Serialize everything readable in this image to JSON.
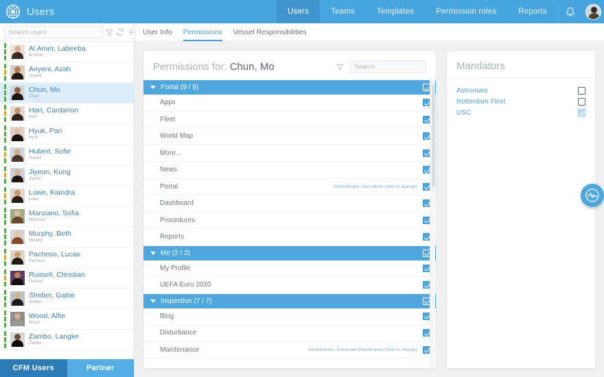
{
  "header": {
    "brand_title": "Users",
    "logo_icon": "compass-wheel-icon",
    "nav": [
      {
        "label": "Users",
        "active": true
      },
      {
        "label": "Teams",
        "active": false
      },
      {
        "label": "Templates",
        "active": false
      },
      {
        "label": "Permission roles",
        "active": false
      },
      {
        "label": "Reports",
        "active": false
      }
    ],
    "bell_icon": "bell-icon",
    "avatar_icon": "user-avatar"
  },
  "sidebar": {
    "search_placeholder": "Search users",
    "search_value": "",
    "tools": [
      {
        "icon": "filter-icon"
      },
      {
        "icon": "refresh-icon"
      },
      {
        "icon": "plus-icon"
      }
    ],
    "users": [
      {
        "name": "Al Amer, Labeeba",
        "sub": "Al Amer",
        "selected": false,
        "skin": "#d8a98c",
        "hair": "#3a2b22",
        "bg": "#e9e2d8",
        "bar2": "green"
      },
      {
        "name": "Anyeni, Azah",
        "sub": "Anyeni",
        "selected": false,
        "skin": "#b07c55",
        "hair": "#241a14",
        "bg": "#d7ccc0",
        "bar2": "amber"
      },
      {
        "name": "Chun, Mo",
        "sub": "Chun",
        "selected": true,
        "skin": "#8d5f3c",
        "hair": "#1f1611",
        "bg": "#cfd5d8",
        "bar2": "green"
      },
      {
        "name": "Hart, Cardarion",
        "sub": "Hart",
        "selected": false,
        "skin": "#c79070",
        "hair": "#30211a",
        "bg": "#e3d9cd",
        "bar2": "amber"
      },
      {
        "name": "Hyuk, Pan",
        "sub": "Hyuk",
        "selected": false,
        "skin": "#e4bda0",
        "hair": "#171210",
        "bg": "#ded3c6",
        "bar2": "green"
      },
      {
        "name": "Hubert, Sofie",
        "sub": "Hubert",
        "selected": false,
        "skin": "#d6a884",
        "hair": "#4a3527",
        "bg": "#cdd6d9",
        "bar2": "amber"
      },
      {
        "name": "Jiyeon, Kung",
        "sub": "Jiyeon",
        "selected": false,
        "skin": "#dcb394",
        "hair": "#20180f",
        "bg": "#c9d2d8",
        "bar2": "amber"
      },
      {
        "name": "Lowe, Kiandra",
        "sub": "Lowe",
        "selected": false,
        "skin": "#c99873",
        "hair": "#2a1d15",
        "bg": "#e0d6c9",
        "bar2": "amber"
      },
      {
        "name": "Manzano, Sofia",
        "sub": "Manzano",
        "selected": false,
        "skin": "#e0bb9b",
        "hair": "#6b4a2c",
        "bg": "#9fae82",
        "bar2": "green"
      },
      {
        "name": "Murphy, Beth",
        "sub": "Murphy",
        "selected": false,
        "skin": "#e8c3a3",
        "hair": "#8a4a28",
        "bg": "#cfd6da",
        "bar2": "green"
      },
      {
        "name": "Pacheco, Lucas",
        "sub": "Pacheco",
        "selected": false,
        "skin": "#cf9d77",
        "hair": "#231a13",
        "bg": "#ddd4c6",
        "bar2": "amber"
      },
      {
        "name": "Russell, Christian",
        "sub": "Russell",
        "selected": false,
        "skin": "#b9825b",
        "hair": "#140f0c",
        "bg": "#5d3a63",
        "bar2": "amber"
      },
      {
        "name": "Sheber, Gabie",
        "sub": "Sheber",
        "selected": false,
        "skin": "#d9ae8c",
        "hair": "#1c1a1f",
        "bg": "#b9c3c9",
        "bar2": "green"
      },
      {
        "name": "Wood, Alfie",
        "sub": "Wood",
        "selected": false,
        "skin": "#d5ad90",
        "hair": "#9d9a95",
        "bg": "#8d8d8a",
        "bar2": "green"
      },
      {
        "name": "Zambo, Langke",
        "sub": "Zambo",
        "selected": false,
        "skin": "#6d4a30",
        "hair": "#100c09",
        "bg": "#d5d8da",
        "bar2": "green"
      }
    ],
    "tabs": [
      {
        "label": "CFM Users",
        "active": true
      },
      {
        "label": "Partner",
        "active": false
      }
    ]
  },
  "main": {
    "tabs": [
      {
        "label": "User Info",
        "active": false
      },
      {
        "label": "Permissions",
        "active": true
      },
      {
        "label": "Vessel Responsibilities",
        "active": false
      }
    ],
    "permissions_panel": {
      "title_prefix": "Permissions for:",
      "title_user": "Chun, Mo",
      "filter_icon": "filter-icon",
      "search_placeholder": "Search",
      "search_value": "",
      "groups": [
        {
          "label": "Portal (9 / 9)",
          "checked": true,
          "items": [
            {
              "label": "Apps",
              "note": "",
              "checked": true
            },
            {
              "label": "Fleet",
              "note": "",
              "checked": true
            },
            {
              "label": "World Map",
              "note": "",
              "checked": true
            },
            {
              "label": "More...",
              "note": "",
              "checked": true
            },
            {
              "label": "News",
              "note": "",
              "checked": true
            },
            {
              "label": "Portal",
              "note": "Administrator, Non Admin (click to change)",
              "checked": true
            },
            {
              "label": "Dashboard",
              "note": "",
              "checked": true
            },
            {
              "label": "Procedures",
              "note": "",
              "checked": true
            },
            {
              "label": "Reports",
              "note": "",
              "checked": true
            }
          ]
        },
        {
          "label": "Me (2 / 2)",
          "checked": true,
          "items": [
            {
              "label": "My Profile",
              "note": "",
              "checked": true
            },
            {
              "label": "UEFA Euro 2020",
              "note": "",
              "checked": true
            }
          ]
        },
        {
          "label": "Inspection (7 / 7)",
          "checked": true,
          "items": [
            {
              "label": "Blog",
              "note": "",
              "checked": true
            },
            {
              "label": "Disturbance",
              "note": "",
              "checked": true
            },
            {
              "label": "Maintenance",
              "note": "Administrator, Astromare Maintenance (click to change)",
              "checked": true
            }
          ]
        }
      ]
    },
    "mandators_panel": {
      "title": "Mandators",
      "items": [
        {
          "label": "Astromare",
          "state": "empty"
        },
        {
          "label": "Rotterdam Fleet",
          "state": "empty"
        },
        {
          "label": "USC",
          "state": "muted"
        }
      ]
    },
    "fab": {
      "icon": "pulse-icon"
    }
  },
  "colors": {
    "accent": "#4fa7dd",
    "topbar": "#48a4dd",
    "topbar_active": "#3f95cc",
    "tab_primary": "#2e7cb5",
    "tab_secondary": "#55aee3",
    "link": "#56a3d8",
    "text": "#6c767d"
  }
}
